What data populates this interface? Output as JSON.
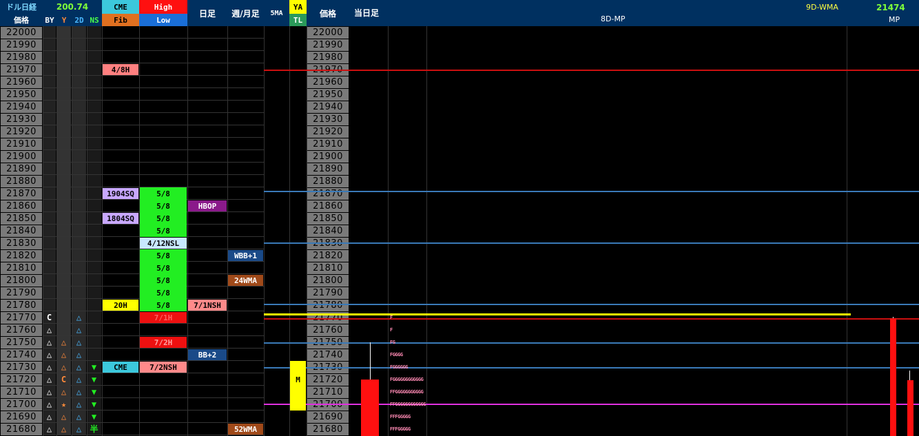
{
  "header": {
    "title": "ドル日経",
    "value": "200.74",
    "price_label": "価格",
    "by": "BY",
    "y": "Y",
    "two_d": "2D",
    "ns": "NS",
    "cme": "CME",
    "fib": "Fib",
    "high": "High",
    "low": "Low",
    "daily": "日足",
    "weekly_monthly": "週/月足",
    "ma5": "5MA",
    "ya": "YA",
    "tl": "TL",
    "price_label2": "価格",
    "today": "当日足",
    "mp8d": "8D-MP",
    "wma9d": "9D-WMA",
    "mp_value": "21474",
    "mp": "MP"
  },
  "prices": [
    "22000",
    "21990",
    "21980",
    "21970",
    "21960",
    "21950",
    "21940",
    "21930",
    "21920",
    "21910",
    "21900",
    "21890",
    "21880",
    "21870",
    "21860",
    "21850",
    "21840",
    "21830",
    "21820",
    "21810",
    "21800",
    "21790",
    "21780",
    "21770",
    "21760",
    "21750",
    "21740",
    "21730",
    "21720",
    "21710",
    "21700",
    "21690",
    "21680"
  ],
  "by_col": [
    "",
    "",
    "",
    "",
    "",
    "",
    "",
    "",
    "",
    "",
    "",
    "",
    "",
    "",
    "",
    "",
    "",
    "",
    "",
    "",
    "",
    "",
    "",
    "C",
    "△",
    "△",
    "△",
    "△",
    "△",
    "△",
    "△",
    "△",
    "△"
  ],
  "y_col": [
    "",
    "",
    "",
    "",
    "",
    "",
    "",
    "",
    "",
    "",
    "",
    "",
    "",
    "",
    "",
    "",
    "",
    "",
    "",
    "",
    "",
    "",
    "",
    "",
    "",
    "△",
    "△",
    "△",
    "C",
    "△",
    "★",
    "△",
    "△"
  ],
  "d2_col": [
    "",
    "",
    "",
    "",
    "",
    "",
    "",
    "",
    "",
    "",
    "",
    "",
    "",
    "",
    "",
    "",
    "",
    "",
    "",
    "",
    "",
    "",
    "",
    "△",
    "△",
    "△",
    "△",
    "△",
    "△",
    "△",
    "△",
    "△",
    "△"
  ],
  "ns_col": [
    "",
    "",
    "",
    "",
    "",
    "",
    "",
    "",
    "",
    "",
    "",
    "",
    "",
    "",
    "",
    "",
    "",
    "",
    "",
    "",
    "",
    "",
    "",
    "",
    "",
    "",
    "",
    "▼",
    "▼",
    "▼",
    "▼",
    "▼",
    "半"
  ],
  "labels": {
    "cme_3": "4/8H",
    "cme_13": "1904SQ",
    "cme_15": "1804SQ",
    "cme_22": "20H",
    "cme_27": "CME",
    "hl_13": "5/8",
    "hl_14": "5/8",
    "hl_15": "5/8",
    "hl_16": "5/8",
    "hl_17": "4/12NSL",
    "hl_18": "5/8",
    "hl_19": "5/8",
    "hl_20": "5/8",
    "hl_21": "5/8",
    "hl_22": "5/8",
    "hl_23": "7/1H",
    "hl_25": "7/2H",
    "hl_27": "7/2NSH",
    "d_14": "HBOP",
    "d_22": "7/1NSH",
    "d_26": "BB+2",
    "w_18": "WBB+1",
    "w_20": "24WMA",
    "w_32": "52WMA",
    "ya_28": "M"
  },
  "tpo": {
    "r23": "F",
    "r24": "F",
    "r25": "FG",
    "r26": "FGGGG",
    "r27": "FGGGGGG",
    "r28": "FGGGGGGGGGGGG",
    "r29": "FFGGGGGGGGGGG",
    "r30": "FFGGGGGGGGGGGG",
    "r31": "FFFGGGGG",
    "r32": "FFFGGGGG"
  },
  "colors": {
    "price_bg": "#7a7a7a",
    "cme_header": "#3cc8dc",
    "fib_header": "#e07020",
    "high_header": "#ff1010",
    "low_header": "#1a6fd8",
    "ya_header": "#ffff00",
    "tl_header": "#2a9a5a",
    "green_block": "#22ee22",
    "red_line": "#cc1010",
    "blue_line": "#3a7ab8",
    "yellow_line": "#ffff00",
    "magenta_line": "#e030e0"
  }
}
